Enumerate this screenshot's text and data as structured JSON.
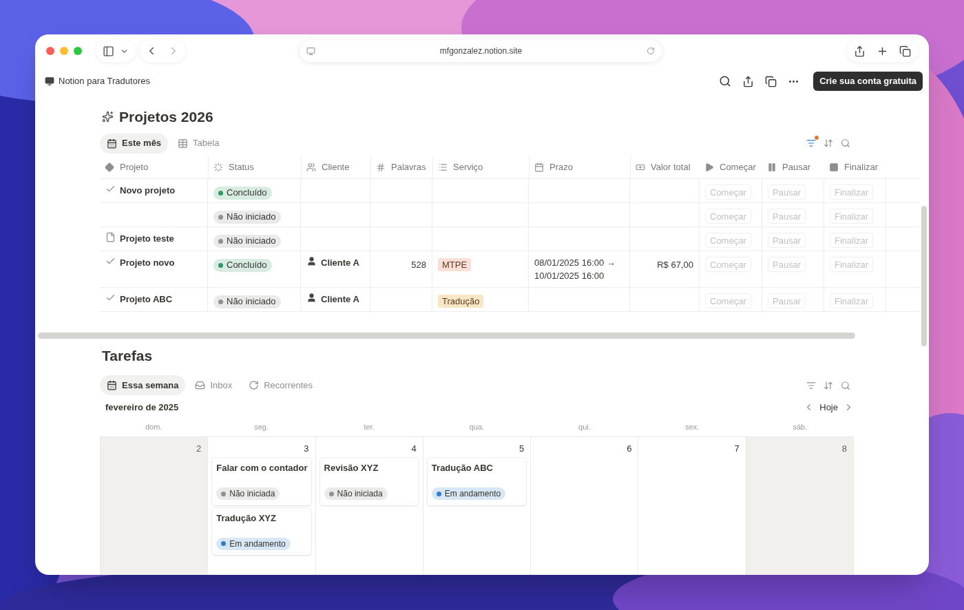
{
  "browser": {
    "url": "mfgonzalez.notion.site"
  },
  "topbar": {
    "breadcrumb": "Notion para Tradutores",
    "cta": "Crie sua conta gratuita"
  },
  "projects": {
    "title": "Projetos 2026",
    "filter_active": true,
    "views": [
      {
        "label": "Este mês",
        "kind": "calendar",
        "selected": true
      },
      {
        "label": "Tabela",
        "kind": "table",
        "selected": false
      }
    ],
    "columns": [
      {
        "label": "Projeto",
        "kind": "title"
      },
      {
        "label": "Status",
        "kind": "status"
      },
      {
        "label": "Cliente",
        "kind": "person"
      },
      {
        "label": "Palavras",
        "kind": "number"
      },
      {
        "label": "Serviço",
        "kind": "select"
      },
      {
        "label": "Prazo",
        "kind": "date"
      },
      {
        "label": "Valor total",
        "kind": "money"
      },
      {
        "label": "Começar",
        "kind": "play"
      },
      {
        "label": "Pausar",
        "kind": "pause"
      },
      {
        "label": "Finalizar",
        "kind": "stop"
      }
    ],
    "rows": [
      {
        "kind": "check",
        "name": "Novo projeto",
        "status": {
          "label": "Concluído",
          "color": "#2f9a65"
        },
        "buttons": [
          "Começar",
          "Pausar",
          "Finalizar"
        ]
      },
      {
        "kind": "none",
        "status": {
          "label": "Não iniciado",
          "color": "#91918e"
        },
        "buttons": [
          "Começar",
          "Pausar",
          "Finalizar"
        ]
      },
      {
        "kind": "page",
        "name": "Projeto teste",
        "status": {
          "label": "Não iniciado",
          "color": "#91918e"
        },
        "buttons": [
          "Começar",
          "Pausar",
          "Finalizar"
        ]
      },
      {
        "kind": "check",
        "name": "Projeto novo",
        "status": {
          "label": "Concluído",
          "color": "#2f9a65"
        },
        "client": "Cliente A",
        "words": "528",
        "service": {
          "label": "MTPE",
          "color": "#fadfd6"
        },
        "deadline": [
          "08/01/2025 16:00 →",
          "10/01/2025 16:00"
        ],
        "value": "R$ 67,00",
        "buttons": [
          "Começar",
          "Pausar",
          "Finalizar"
        ]
      },
      {
        "kind": "check",
        "name": "Projeto ABC",
        "status": {
          "label": "Não iniciado",
          "color": "#91918e"
        },
        "client": "Cliente A",
        "service": {
          "label": "Tradução",
          "color": "#f8e7c4"
        },
        "buttons": [
          "Começar",
          "Pausar",
          "Finalizar"
        ]
      }
    ]
  },
  "tasks": {
    "title": "Tarefas",
    "month": "fevereiro de 2025",
    "today": "Hoje",
    "views": [
      {
        "label": "Essa semana",
        "kind": "calendar",
        "selected": true
      },
      {
        "label": "Inbox",
        "kind": "inbox",
        "selected": false
      },
      {
        "label": "Recorrentes",
        "kind": "repeat",
        "selected": false
      }
    ],
    "days": [
      {
        "weekday": "dom.",
        "date": "2",
        "weekend": true
      },
      {
        "weekday": "seg.",
        "date": "3",
        "weekend": false,
        "tasks": [
          {
            "title": "Falar com o contador",
            "status": {
              "label": "Não iniciada",
              "color": "#91918e"
            }
          },
          {
            "title": "Tradução XYZ",
            "status": {
              "label": "Em andamento",
              "color": "#2f7fd0"
            }
          }
        ]
      },
      {
        "weekday": "ter.",
        "date": "4",
        "weekend": false,
        "tasks": [
          {
            "title": "Revisão XYZ",
            "status": {
              "label": "Não iniciada",
              "color": "#91918e"
            }
          }
        ]
      },
      {
        "weekday": "qua.",
        "date": "5",
        "weekend": false,
        "tasks": [
          {
            "title": "Tradução ABC",
            "status": {
              "label": "Em andamento",
              "color": "#2f7fd0"
            }
          }
        ]
      },
      {
        "weekday": "qui.",
        "date": "6",
        "weekend": false
      },
      {
        "weekday": "sex.",
        "date": "7",
        "weekend": false
      },
      {
        "weekday": "sáb.",
        "date": "8",
        "weekend": true
      }
    ]
  }
}
